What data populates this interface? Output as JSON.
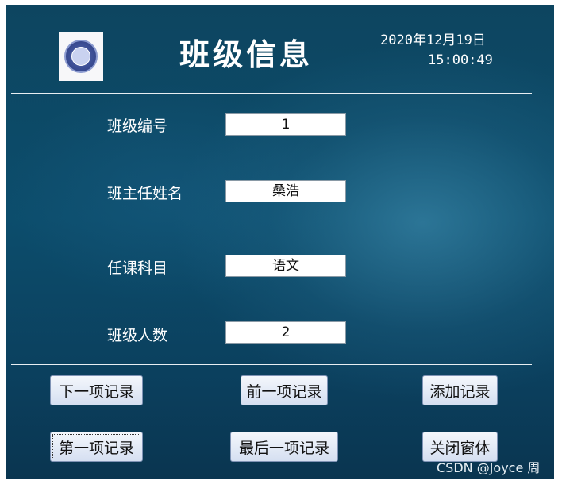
{
  "header": {
    "title": "班级信息",
    "date": "2020年12月19日",
    "time": "15:00:49"
  },
  "fields": [
    {
      "label": "班级编号",
      "value": "1"
    },
    {
      "label": "班主任姓名",
      "value": "桑浩"
    },
    {
      "label": "任课科目",
      "value": "语文"
    },
    {
      "label": "班级人数",
      "value": "2"
    }
  ],
  "buttons": {
    "next": "下一项记录",
    "prev": "前一项记录",
    "add": "添加记录",
    "first": "第一项记录",
    "last": "最后一项记录",
    "close": "关闭窗体"
  },
  "watermark": "CSDN @Joyce 周"
}
